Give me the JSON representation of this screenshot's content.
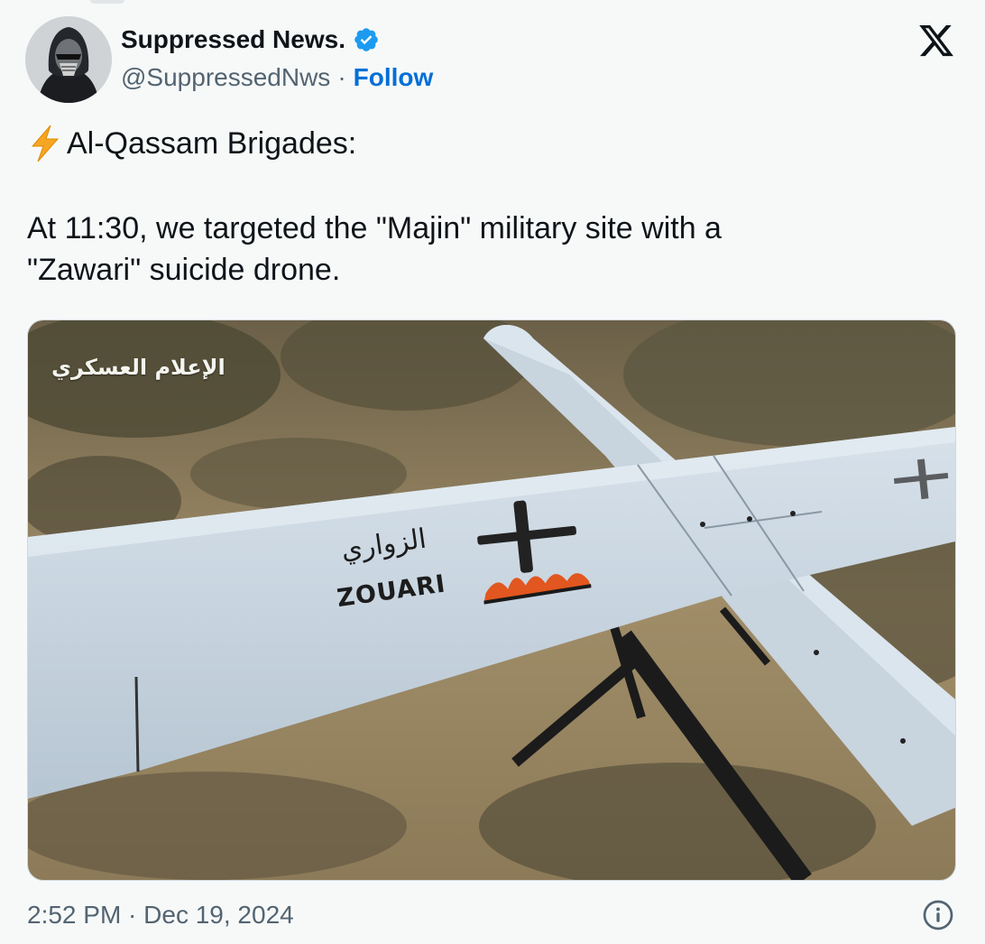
{
  "author": {
    "display_name": "Suppressed News.",
    "handle": "@SuppressedNws",
    "separator": "·",
    "follow_label": "Follow",
    "verified": true
  },
  "tweet": {
    "line1": "Al-Qassam Brigades:",
    "line2": "At 11:30, we targeted the \"Majin\" military site with a",
    "line3": "\"Zawari\" suicide drone.",
    "bolt_icon": "high-voltage-emoji"
  },
  "media": {
    "watermark": "الإعلام العسكري",
    "wing_arabic": "الزواري",
    "wing_brand": "ZOUARI"
  },
  "footer": {
    "timestamp": "2:52 PM · Dec 19, 2024",
    "info_icon": "info-icon"
  },
  "colors": {
    "accent": "#006fd6",
    "verified": "#1d9bf0",
    "muted": "#536471",
    "background": "#f7f9f9"
  }
}
